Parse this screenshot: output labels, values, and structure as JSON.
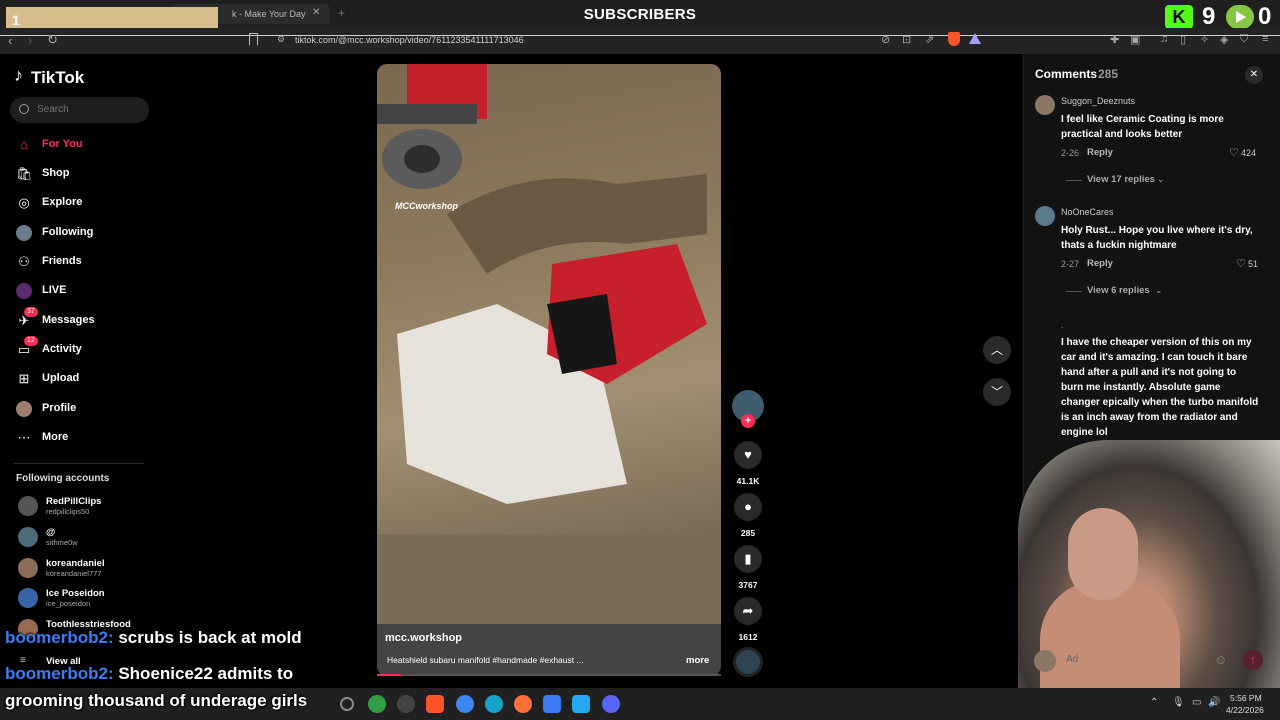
{
  "stream": {
    "subscribers_label": "SUBSCRIBERS",
    "goal_count": "1",
    "kick_count": "9",
    "rumble_count": "0"
  },
  "browser": {
    "tab_title": "k - Make Your Day",
    "url": "tiktok.com/@mcc.workshop/video/7611233541111713046"
  },
  "sidebar": {
    "logo": "TikTok",
    "search_placeholder": "Search",
    "nav": [
      {
        "label": "For You",
        "icon": "home-icon"
      },
      {
        "label": "Shop",
        "icon": "shop-icon"
      },
      {
        "label": "Explore",
        "icon": "compass-icon"
      },
      {
        "label": "Following",
        "icon": "avatar"
      },
      {
        "label": "Friends",
        "icon": "friends-icon"
      },
      {
        "label": "LIVE",
        "icon": "live-icon"
      },
      {
        "label": "Messages",
        "icon": "messages-icon",
        "badge": "37"
      },
      {
        "label": "Activity",
        "icon": "activity-icon",
        "badge": "12"
      },
      {
        "label": "Upload",
        "icon": "upload-icon"
      },
      {
        "label": "Profile",
        "icon": "avatar"
      },
      {
        "label": "More",
        "icon": "more-icon"
      }
    ],
    "following_header": "Following accounts",
    "accounts": [
      {
        "name": "RedPillClips",
        "handle": "redpillclips50"
      },
      {
        "name": "@",
        "handle": "sithme0w"
      },
      {
        "name": "koreandaniel",
        "handle": "koreandaniel777"
      },
      {
        "name": "Ice Poseidon",
        "handle": "ice_poseidon"
      },
      {
        "name": "Toothlesstriesfood",
        "handle": ""
      }
    ],
    "view_all": "View all"
  },
  "video": {
    "author": "mcc.workshop",
    "caption": "Heatshield subaru manifold #handmade #exhaust ...",
    "more": "more",
    "watermark": "MCCworkshop",
    "progress": 0.07,
    "likes": "41.1K",
    "comments": "285",
    "saves": "3767",
    "shares": "1612"
  },
  "comments": {
    "title": "Comments",
    "count": "285",
    "items": [
      {
        "user": "Suggon_Deeznuts",
        "text": "I feel like Ceramic Coating is more practical and looks better",
        "date": "2-26",
        "reply": "Reply",
        "likes": "424",
        "replies": "View 17 replies"
      },
      {
        "user": "NoOneCares",
        "text": "Holy Rust... Hope you live where it's dry, thats a fuckin nightmare",
        "date": "2-27",
        "reply": "Reply",
        "likes": "51",
        "replies": "View 6 replies"
      },
      {
        "user": ".",
        "text": "I have the cheaper version of this on my car and it's amazing. I can touch it bare hand after a pull and it's not going to burn me instantly. Absolute game changer epically when the turbo manifold is an inch away from the radiator and engine lol"
      }
    ],
    "add_placeholder": "Ad"
  },
  "chat": [
    {
      "user": "boomerbob2:",
      "text": " scrubs is back at mold"
    },
    {
      "user": "boomerbob2:",
      "text": " Shoenice22 admits to"
    },
    {
      "user": "",
      "text": "grooming thousand of underage girls"
    }
  ],
  "taskbar": {
    "time": "5:56 PM",
    "date": "4/22/2026"
  }
}
